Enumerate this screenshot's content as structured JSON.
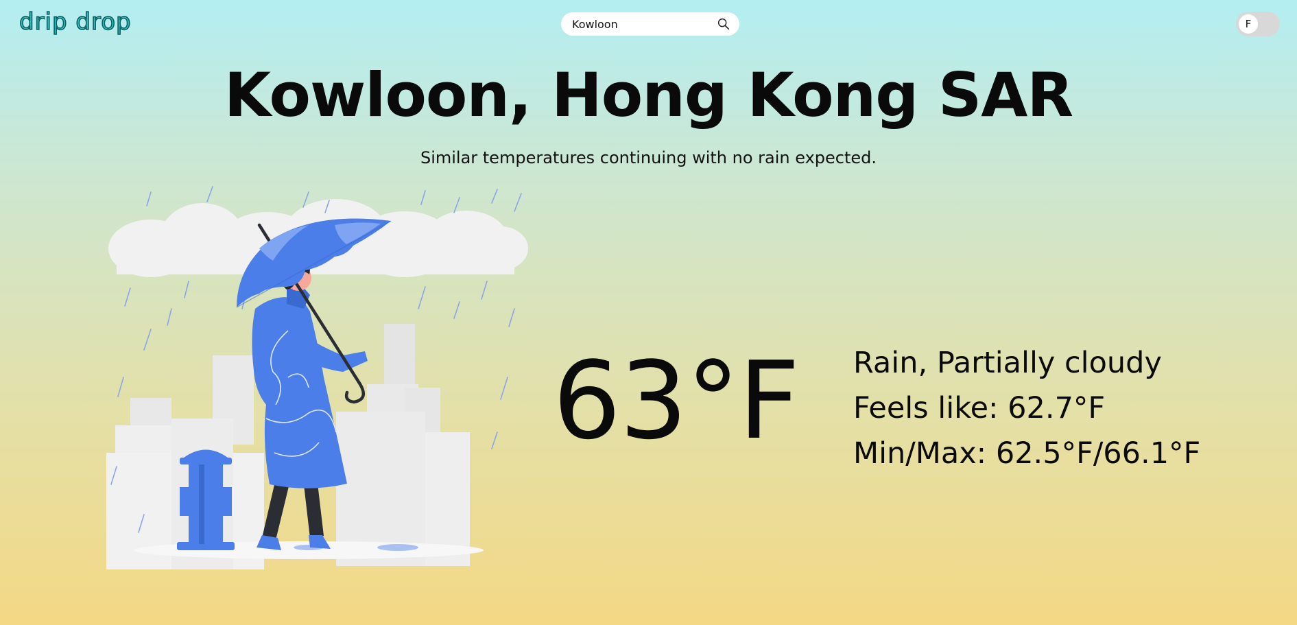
{
  "header": {
    "logo_text": "drip drop",
    "search": {
      "value": "Kowloon",
      "icon": "search-icon"
    },
    "unit_toggle": {
      "label": "F"
    }
  },
  "location": {
    "title": "Kowloon, Hong Kong SAR",
    "summary": "Similar temperatures continuing with no rain expected."
  },
  "weather": {
    "temperature": "63°F",
    "conditions": "Rain, Partially cloudy",
    "feels_like": "Feels like: 62.7°F",
    "min_max": "Min/Max: 62.5°F/66.1°F"
  },
  "colors": {
    "accent": "#2fc6c6",
    "illustration_blue": "#4b7ee8",
    "toggle_track": "#d8d8d8"
  }
}
